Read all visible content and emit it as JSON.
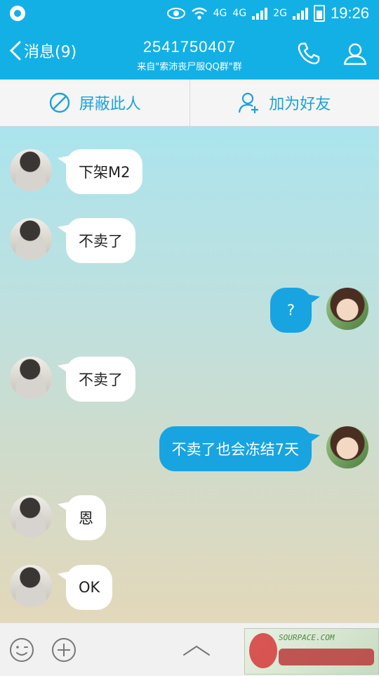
{
  "status_bar": {
    "network_1": "4G",
    "network_2": "4G",
    "network_3": "2G",
    "time": "19:26"
  },
  "header": {
    "back_label": "消息(9)",
    "title": "2541750407",
    "subtitle": "来自\"索沛丧尸服QQ群\"群"
  },
  "actions": {
    "block_label": "屏蔽此人",
    "add_friend_label": "加为好友"
  },
  "messages": [
    {
      "side": "in",
      "text": "下架M2"
    },
    {
      "side": "in",
      "text": "不卖了"
    },
    {
      "side": "out",
      "text": "?"
    },
    {
      "side": "in",
      "text": "不卖了"
    },
    {
      "side": "out",
      "text": "不卖了也会冻结7天"
    },
    {
      "side": "in",
      "text": "恩"
    },
    {
      "side": "in",
      "text": "OK"
    }
  ],
  "watermark": {
    "text": "SOURPACE.COM"
  },
  "colors": {
    "accent": "#13b0e6",
    "outgoing_bubble": "#18a4e0",
    "action_text": "#1aa2d9"
  }
}
